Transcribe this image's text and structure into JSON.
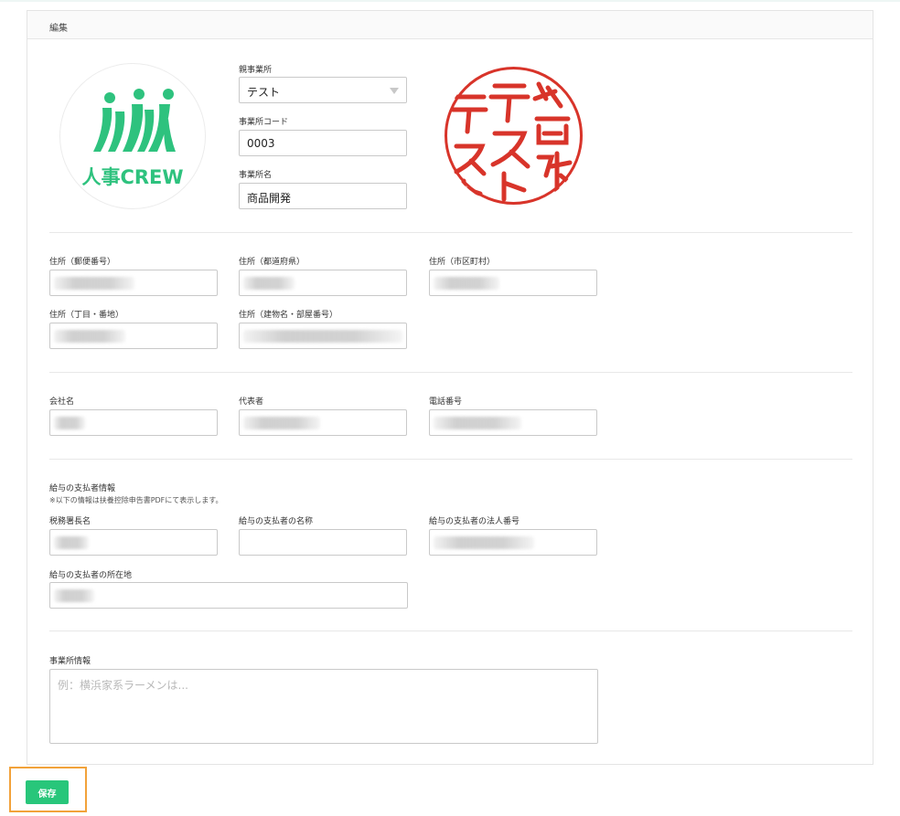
{
  "card": {
    "title": "編集"
  },
  "logo": {
    "brand_text": "人事CREW",
    "accent_color": "#2ec27e"
  },
  "seal": {
    "text": "株式会社テスト",
    "color": "#d8342a"
  },
  "office": {
    "parent_office_label": "親事業所",
    "parent_office_value": "テスト",
    "office_code_label": "事業所コード",
    "office_code_value": "0003",
    "office_name_label": "事業所名",
    "office_name_value": "商品開発"
  },
  "address": {
    "postal_label": "住所（郵便番号）",
    "prefecture_label": "住所（都道府県）",
    "city_label": "住所（市区町村）",
    "street_label": "住所（丁目・番地）",
    "building_label": "住所（建物名・部屋番号）"
  },
  "company": {
    "company_name_label": "会社名",
    "representative_label": "代表者",
    "phone_label": "電話番号"
  },
  "payer": {
    "section_title": "給与の支払者情報",
    "note": "※以下の情報は扶養控除申告書PDFにて表示します。",
    "tax_office_label": "税務署長名",
    "payer_name_label": "給与の支払者の名称",
    "corporate_number_label": "給与の支払者の法人番号",
    "payer_address_label": "給与の支払者の所在地"
  },
  "office_info": {
    "label": "事業所情報",
    "placeholder": "例：横浜家系ラーメンは..."
  },
  "actions": {
    "save_label": "保存",
    "save_color": "#28c67a",
    "highlight_color": "#f2a23a"
  }
}
